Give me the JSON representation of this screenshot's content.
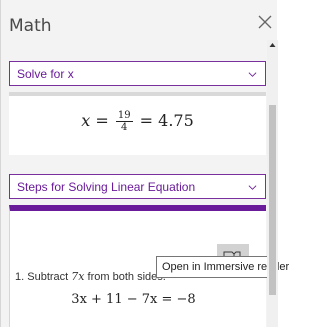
{
  "header": {
    "title": "Math",
    "close_icon": "close-icon"
  },
  "solve_dropdown": {
    "selected": "Solve for x",
    "icon": "chevron-down-icon"
  },
  "result": {
    "lhs": "x",
    "equals": "=",
    "numerator": "19",
    "denominator": "4",
    "equals2": "=",
    "decimal": "4.75"
  },
  "steps_dropdown": {
    "selected": "Steps for Solving Linear Equation",
    "icon": "chevron-down-icon"
  },
  "immersive_reader": {
    "icon": "immersive-reader-icon",
    "tooltip": "Open in Immersive reader"
  },
  "step1": {
    "number": "1.",
    "text_before": "Subtract",
    "term": "7x",
    "text_after": "from both sides."
  },
  "step1_equation": "3x + 11 − 7x = −8",
  "colors": {
    "accent": "#6a1b9a",
    "pane_bg": "#f3f3f3",
    "button_bg": "#d2d2d2"
  }
}
